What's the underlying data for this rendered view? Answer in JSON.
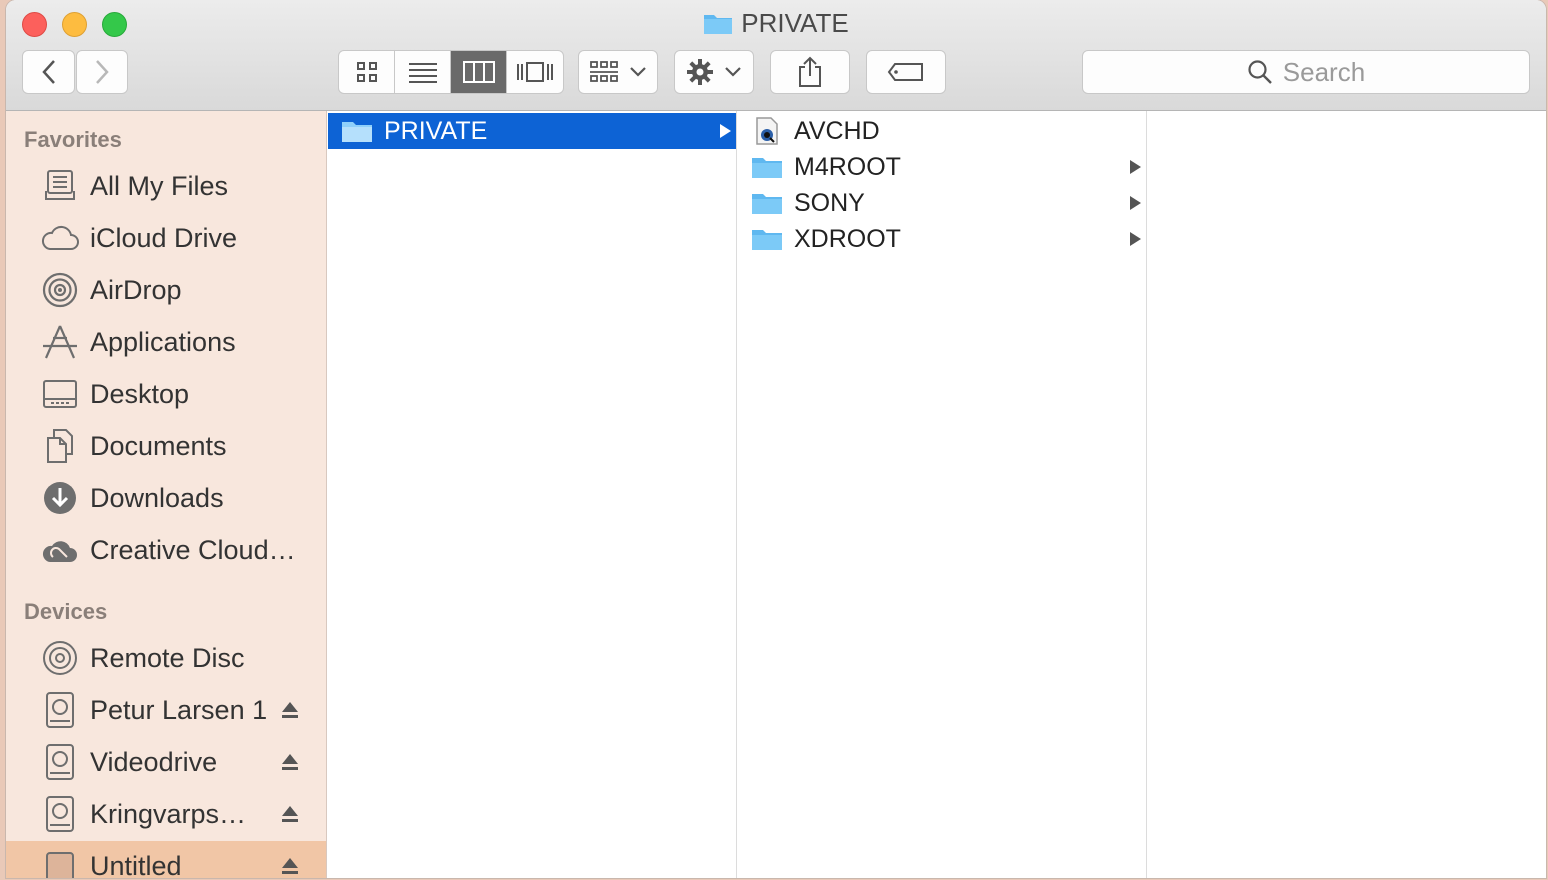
{
  "window": {
    "title": "PRIVATE"
  },
  "toolbar": {
    "search_placeholder": "Search"
  },
  "sidebar": {
    "favorites_header": "Favorites",
    "favorites": [
      {
        "label": "All My Files",
        "icon": "all-files-icon"
      },
      {
        "label": "iCloud Drive",
        "icon": "cloud-icon"
      },
      {
        "label": "AirDrop",
        "icon": "airdrop-icon"
      },
      {
        "label": "Applications",
        "icon": "applications-icon"
      },
      {
        "label": "Desktop",
        "icon": "desktop-icon"
      },
      {
        "label": "Documents",
        "icon": "documents-icon"
      },
      {
        "label": "Downloads",
        "icon": "downloads-icon"
      },
      {
        "label": "Creative Cloud…",
        "icon": "creative-cloud-icon"
      }
    ],
    "devices_header": "Devices",
    "devices": [
      {
        "label": "Remote Disc",
        "icon": "disc-icon",
        "eject": false
      },
      {
        "label": "Petur Larsen 1",
        "icon": "drive-icon",
        "eject": true
      },
      {
        "label": "Videodrive",
        "icon": "drive-icon",
        "eject": true
      },
      {
        "label": "Kringvarps…",
        "icon": "drive-icon",
        "eject": true
      },
      {
        "label": "Untitled",
        "icon": "drive-icon",
        "eject": true,
        "selected": true
      }
    ]
  },
  "columns": {
    "col1": [
      {
        "label": "PRIVATE",
        "type": "folder",
        "selected": true,
        "has_children": true
      }
    ],
    "col2": [
      {
        "label": "AVCHD",
        "type": "package",
        "has_children": false
      },
      {
        "label": "M4ROOT",
        "type": "folder",
        "has_children": true
      },
      {
        "label": "SONY",
        "type": "folder",
        "has_children": true
      },
      {
        "label": "XDROOT",
        "type": "folder",
        "has_children": true
      }
    ]
  },
  "colors": {
    "selection": "#0d63d5",
    "folder": "#5fb8f0",
    "sidebar_bg": "#f8e7dd"
  }
}
